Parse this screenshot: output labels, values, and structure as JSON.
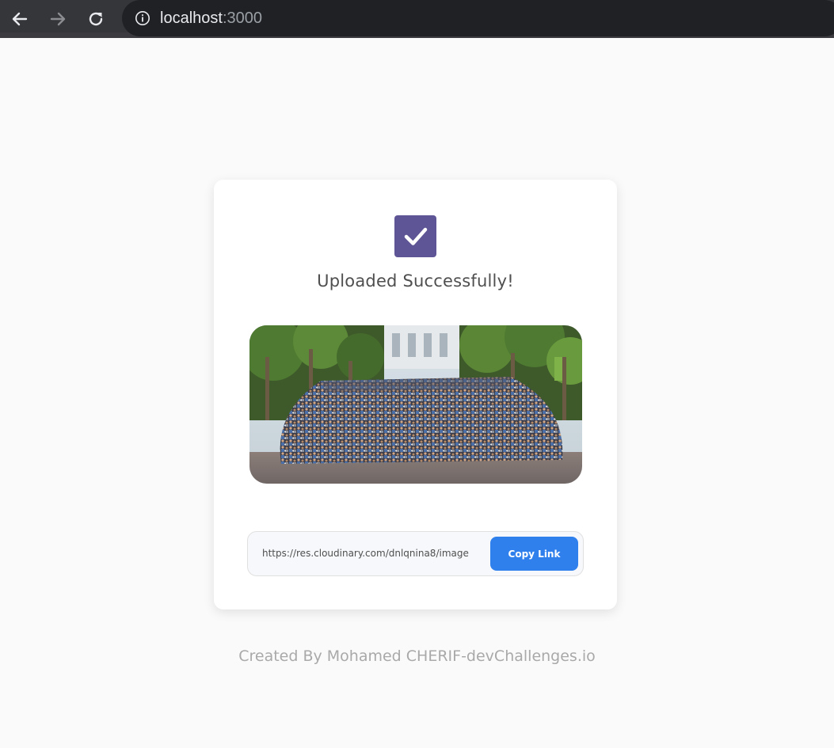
{
  "browser": {
    "url_host": "localhost",
    "url_port": ":3000",
    "icons": {
      "back": "back-arrow-icon",
      "forward": "forward-arrow-icon",
      "reload": "reload-icon",
      "info": "info-icon"
    }
  },
  "card": {
    "icon": "check-icon",
    "title": "Uploaded Successfully!",
    "image": "uploaded-photo",
    "link": "https://res.cloudinary.com/dnlqnina8/image",
    "copy_label": "Copy Link"
  },
  "footer": {
    "text": "Created By Mohamed CHERIF-devChallenges.io"
  },
  "colors": {
    "accent": "#2f80ed",
    "check_bg": "#5e5596",
    "page_bg": "#fafafa"
  }
}
